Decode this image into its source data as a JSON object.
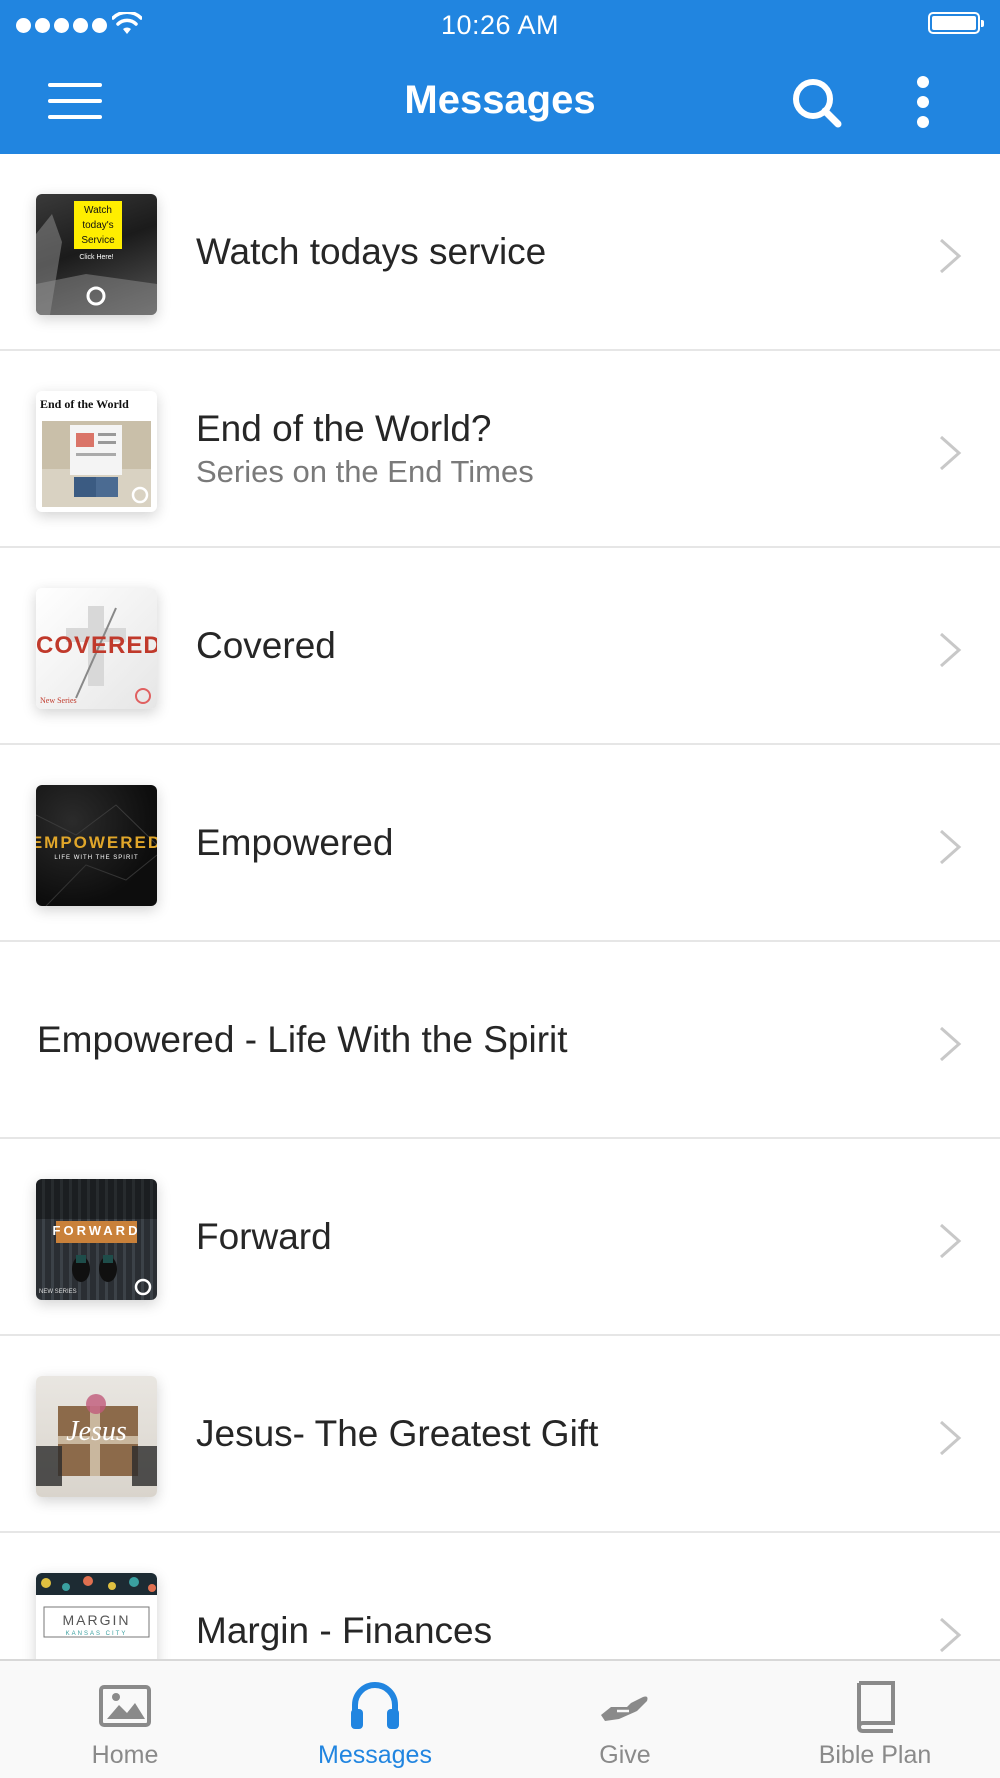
{
  "status_bar": {
    "time": "10:26 AM"
  },
  "header": {
    "title": "Messages"
  },
  "messages": [
    {
      "title": "Watch todays service",
      "subtitle": "",
      "thumb_text": [
        "Watch",
        "today's",
        "Service",
        "Click Here!"
      ]
    },
    {
      "title": "End of the World?",
      "subtitle": "Series on the End Times",
      "thumb_text": [
        "End of the World"
      ]
    },
    {
      "title": "Covered",
      "subtitle": "",
      "thumb_text": [
        "COVERED",
        "New Series"
      ]
    },
    {
      "title": "Empowered",
      "subtitle": "",
      "thumb_text": [
        "EMPOWERED",
        "LIFE WITH THE SPIRIT"
      ]
    },
    {
      "title": "Empowered - Life With the Spirit",
      "subtitle": ""
    },
    {
      "title": "Forward",
      "subtitle": "",
      "thumb_text": [
        "FORWARD",
        "NEW SERIES"
      ]
    },
    {
      "title": "Jesus- The Greatest Gift",
      "subtitle": "",
      "thumb_text": [
        "Jesus"
      ]
    },
    {
      "title": "Margin - Finances",
      "subtitle": "",
      "thumb_text": [
        "MARGIN",
        "KANSAS CITY"
      ]
    }
  ],
  "tabs": [
    {
      "label": "Home",
      "icon": "image-icon",
      "active": false
    },
    {
      "label": "Messages",
      "icon": "headphones-icon",
      "active": true
    },
    {
      "label": "Give",
      "icon": "giving-hand-icon",
      "active": false
    },
    {
      "label": "Bible Plan",
      "icon": "book-icon",
      "active": false
    }
  ],
  "colors": {
    "accent": "#2185e0",
    "tab_inactive": "#8a8a8a",
    "divider": "#e6e6e6"
  }
}
